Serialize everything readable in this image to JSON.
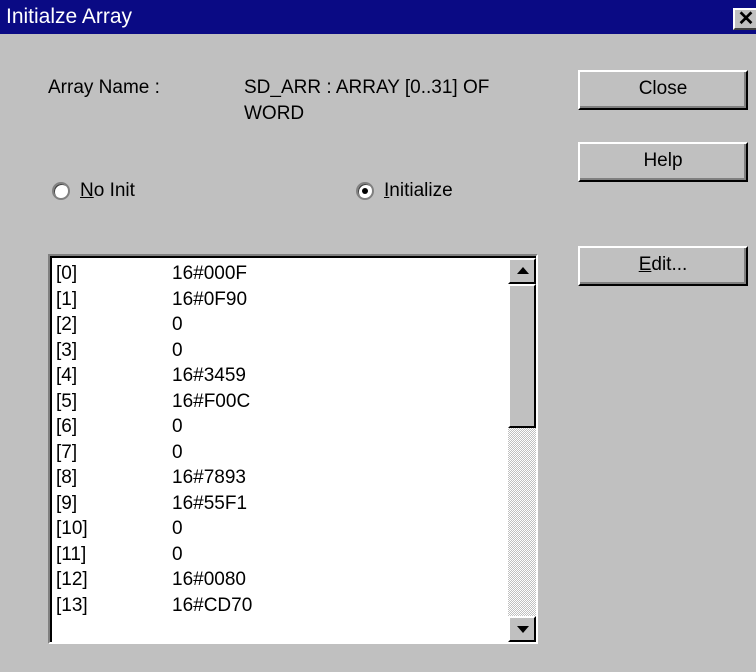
{
  "window": {
    "title": "Initialze Array"
  },
  "array": {
    "name_label": "Array Name :",
    "name_value_line1": "SD_ARR : ARRAY [0..31] OF",
    "name_value_line2": "WORD"
  },
  "buttons": {
    "close": "Close",
    "help": "Help",
    "edit": "Edit..."
  },
  "radios": {
    "no_init": {
      "label": "No Init",
      "selected": false
    },
    "initialize": {
      "label": "Initialize",
      "selected": true
    }
  },
  "list": {
    "rows": [
      {
        "index": "[0]",
        "value": "16#000F"
      },
      {
        "index": "[1]",
        "value": "16#0F90"
      },
      {
        "index": "[2]",
        "value": "0"
      },
      {
        "index": "[3]",
        "value": "0"
      },
      {
        "index": "[4]",
        "value": "16#3459"
      },
      {
        "index": "[5]",
        "value": "16#F00C"
      },
      {
        "index": "[6]",
        "value": "0"
      },
      {
        "index": "[7]",
        "value": "0"
      },
      {
        "index": "[8]",
        "value": "16#7893"
      },
      {
        "index": "[9]",
        "value": "16#55F1"
      },
      {
        "index": "[10]",
        "value": "0"
      },
      {
        "index": "[11]",
        "value": "0"
      },
      {
        "index": "[12]",
        "value": "16#0080"
      },
      {
        "index": "[13]",
        "value": "16#CD70"
      }
    ]
  }
}
